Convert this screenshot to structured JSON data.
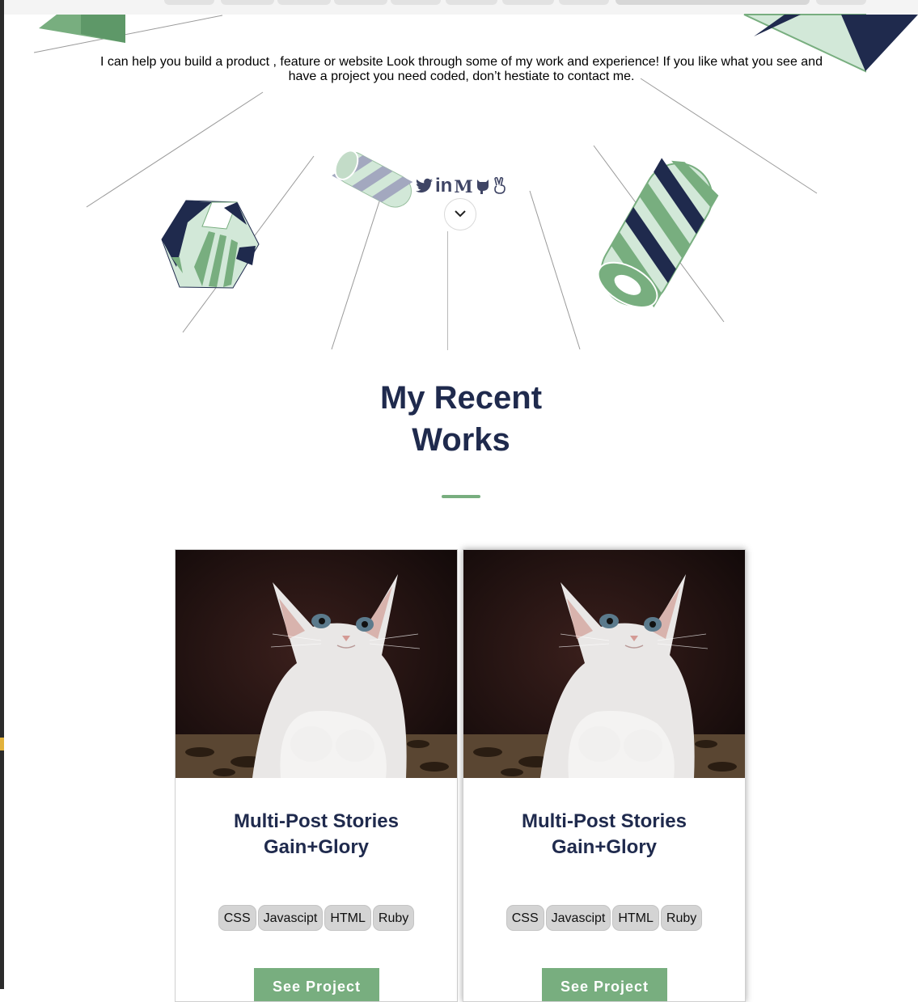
{
  "intro": {
    "text": "I can help you build a product , feature or website Look through some of my work and experience! If you like what you see and have a project you need coded, don’t hestiate to contact me."
  },
  "social": [
    {
      "icon": "twitter-icon"
    },
    {
      "icon": "linkedin-icon",
      "label": "in"
    },
    {
      "icon": "medium-icon",
      "label": "M"
    },
    {
      "icon": "github-icon"
    },
    {
      "icon": "angellist-icon"
    }
  ],
  "scroll": {
    "icon": "chevron-down-icon"
  },
  "works": {
    "title": "My Recent Works",
    "projects": [
      {
        "title": "Multi-Post Stories Gain+Glory",
        "image": "kitten-photo",
        "tags": [
          "CSS",
          "Javascipt",
          "HTML",
          "Ruby"
        ],
        "button_label": "See Project"
      },
      {
        "title": "Multi-Post Stories Gain+Glory",
        "image": "kitten-photo",
        "tags": [
          "CSS",
          "Javascipt",
          "HTML",
          "Ruby"
        ],
        "button_label": "See Project"
      }
    ]
  },
  "colors": {
    "navy": "#1f2a4d",
    "green": "#78ae7f",
    "mint": "#d2e8d8",
    "tag_bg": "#d4d4d4"
  }
}
